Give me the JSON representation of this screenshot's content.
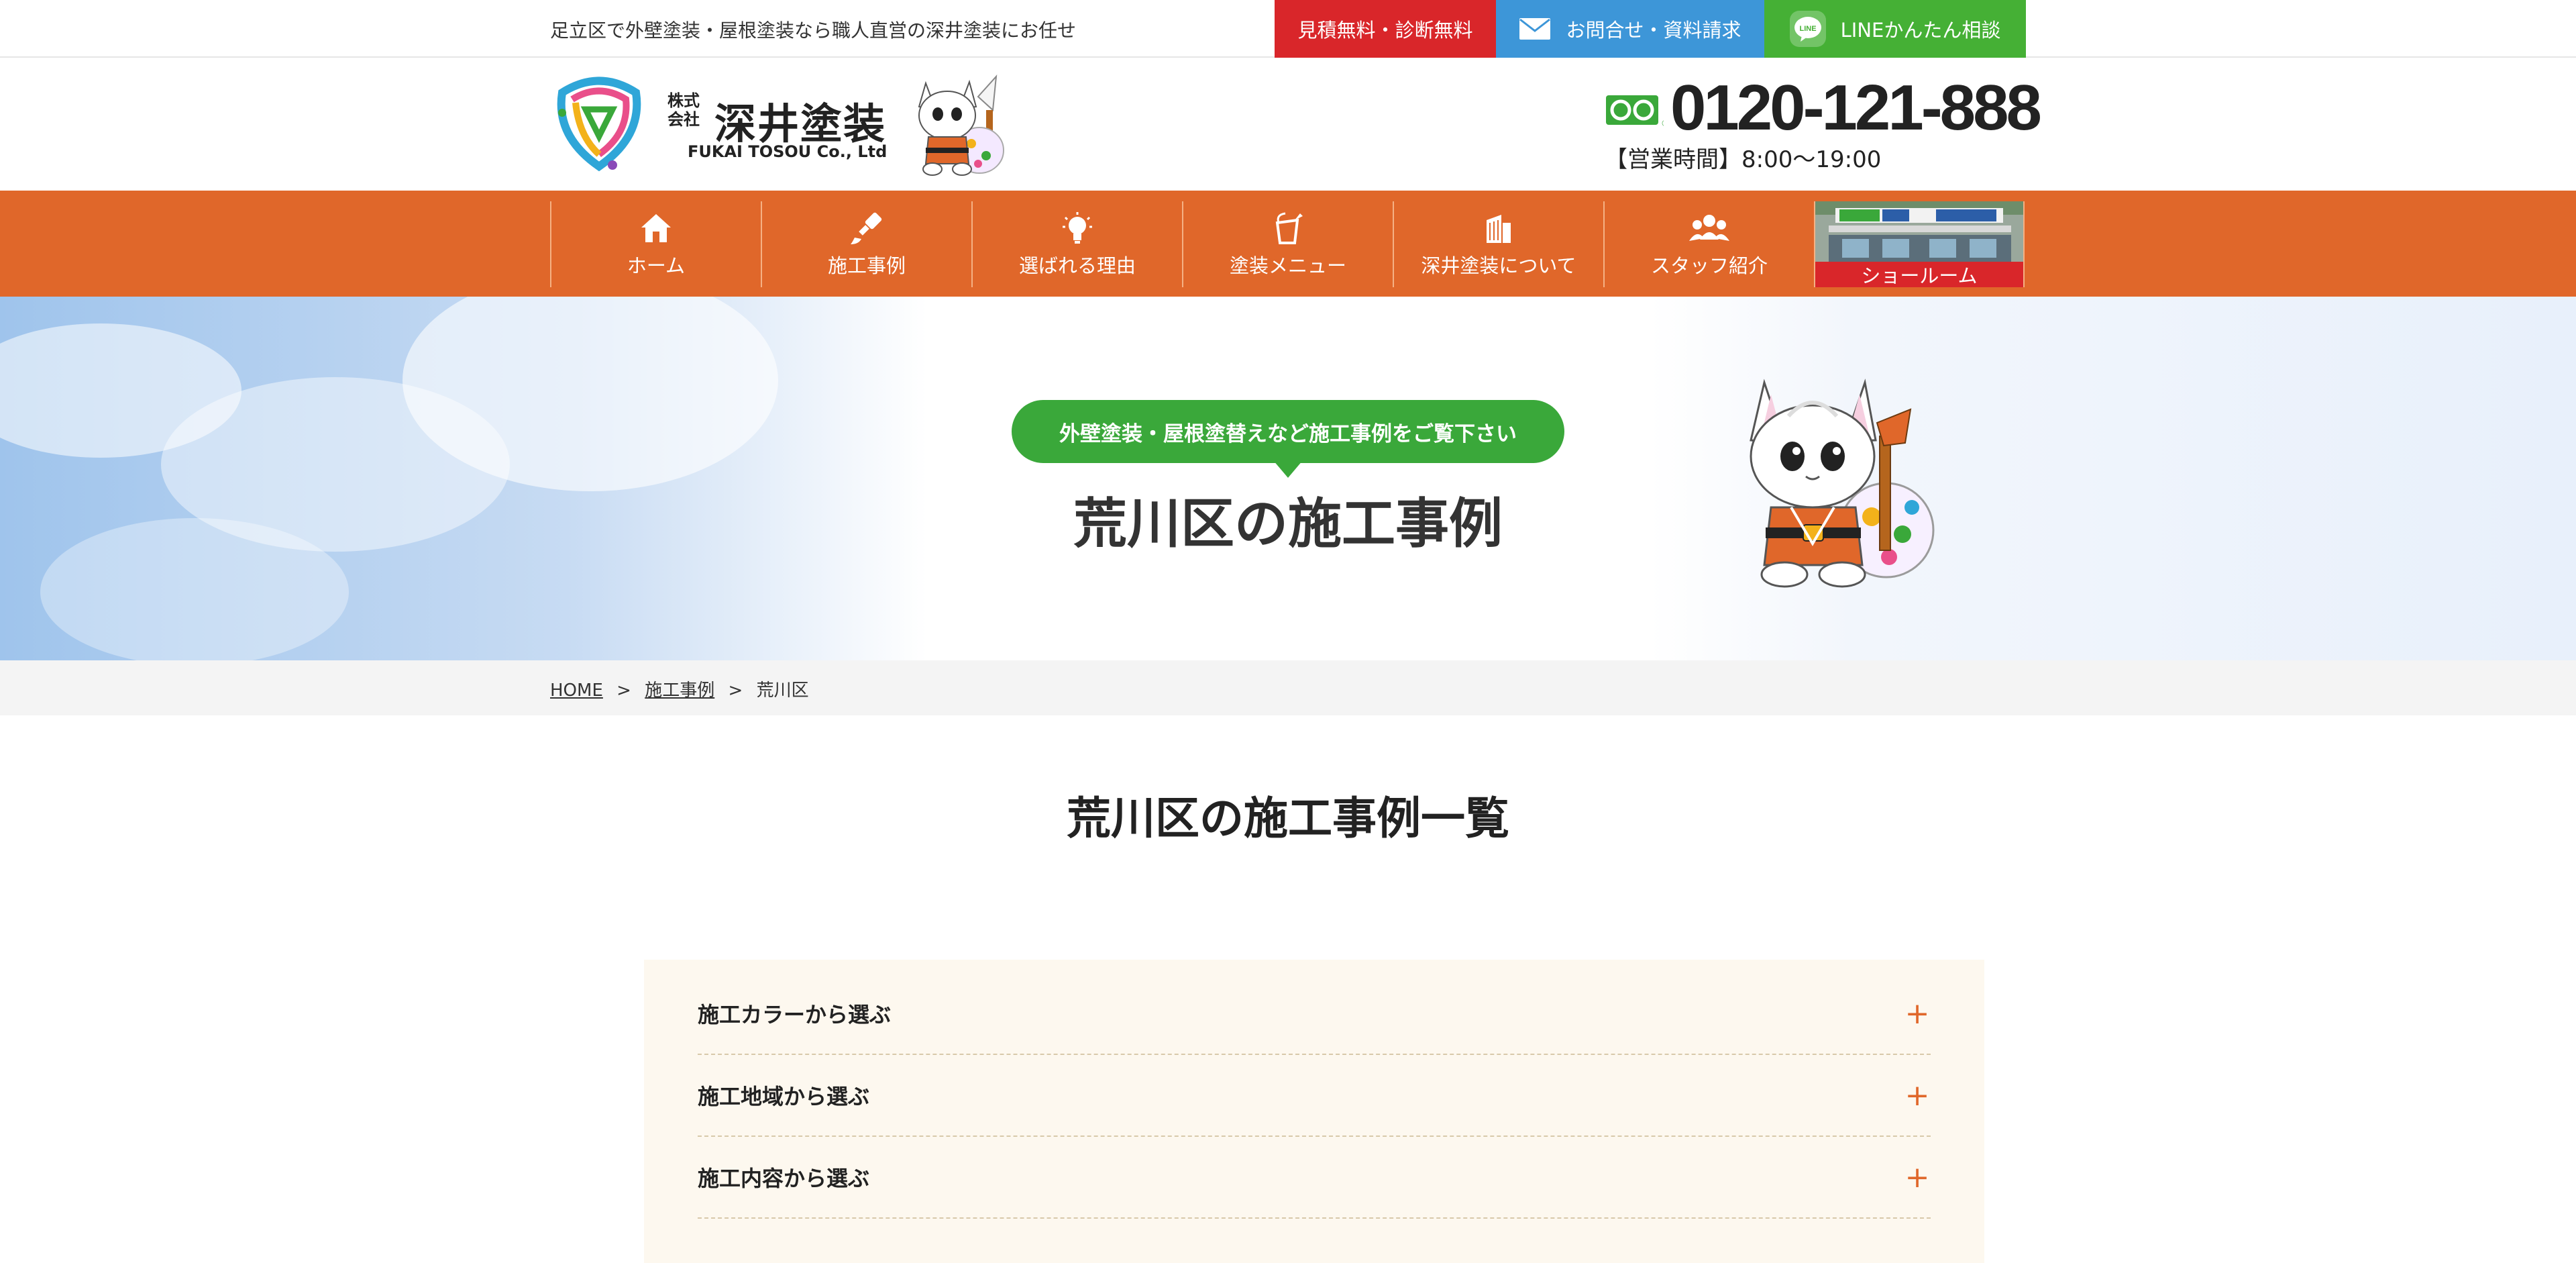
{
  "topbar": {
    "tagline": "足立区で外壁塗装・屋根塗装なら職人直営の深井塗装にお任せ",
    "estimate_label": "見積無料・診断無料",
    "contact_label": "お問合せ・資料請求",
    "line_label": "LINEかんたん相談"
  },
  "header": {
    "logo_kabu": "株式会社",
    "logo_name": "深井塗装",
    "logo_en": "FUKAI TOSOU Co., Ltd",
    "phone": "0120-121-888",
    "hours": "【営業時間】8:00〜19:00"
  },
  "nav": {
    "items": [
      {
        "label": "ホーム",
        "icon": "home-icon"
      },
      {
        "label": "施工事例",
        "icon": "paintbrush-icon"
      },
      {
        "label": "選ばれる理由",
        "icon": "lightbulb-icon"
      },
      {
        "label": "塗装メニュー",
        "icon": "paint-bucket-icon"
      },
      {
        "label": "深井塗装について",
        "icon": "building-icon"
      },
      {
        "label": "スタッフ紹介",
        "icon": "staff-group-icon"
      },
      {
        "label": "ショールーム",
        "icon": "showroom-photo"
      }
    ]
  },
  "hero": {
    "ribbon": "外壁塗装・屋根塗替えなど施工事例をご覧下さい",
    "title": "荒川区の施工事例"
  },
  "breadcrumb": {
    "home": "HOME",
    "cases": "施工事例",
    "current": "荒川区",
    "separator": ">"
  },
  "section": {
    "title": "荒川区の施工事例一覧"
  },
  "filters": [
    {
      "label": "施工カラーから選ぶ",
      "toggle": "+"
    },
    {
      "label": "施工地域から選ぶ",
      "toggle": "+"
    },
    {
      "label": "施工内容から選ぶ",
      "toggle": "+"
    }
  ],
  "colors": {
    "accent_orange": "#e0672a",
    "estimate_red": "#d9262a",
    "contact_blue": "#3d96d8",
    "line_green": "#45b035",
    "ribbon_green": "#3aa83a",
    "filter_bg": "#fdf8ef"
  }
}
